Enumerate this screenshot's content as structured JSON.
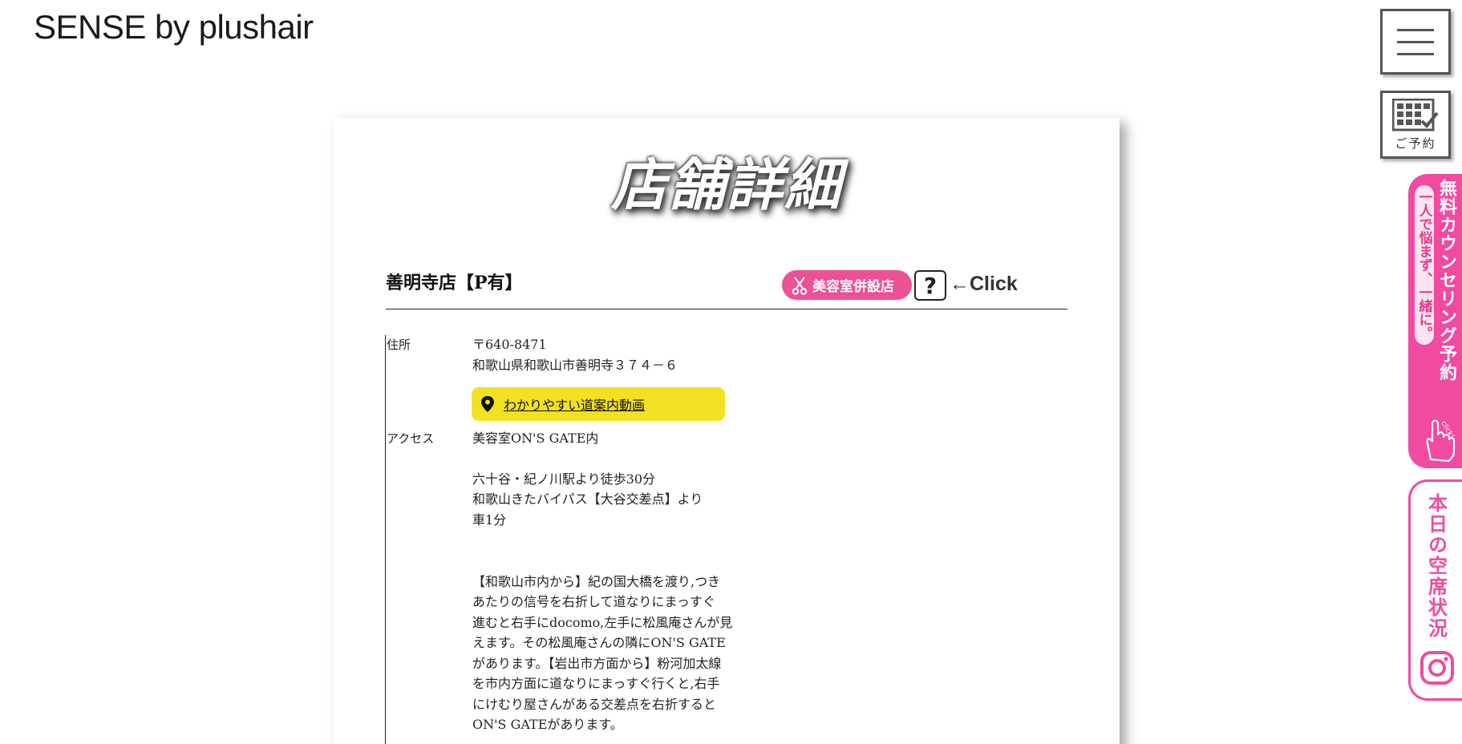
{
  "header": {
    "logo": "SENSE by plushair"
  },
  "side_controls": {
    "reserve_label": "ご予約",
    "counseling_main": "無料カウンセリング予約",
    "counseling_sub": "一人で悩まず、一緒に。",
    "counseling_click": "click!",
    "vacancy_label": "本日の空席状況"
  },
  "page": {
    "title": "店舗詳細"
  },
  "store": {
    "name": "善明寺店【P有】",
    "badge": "美容室併設店",
    "help_symbol": "?",
    "click_hint": "←Click"
  },
  "info": {
    "address_label": "住所",
    "postal": "〒640-8471",
    "address": "和歌山県和歌山市善明寺３７４－６",
    "route_button": "わかりやすい道案内動画",
    "access_label": "アクセス",
    "access_lines": [
      "美容室ON'S GATE内",
      "六十谷・紀ノ川駅より徒歩30分",
      "和歌山きたバイパス【大谷交差点】より",
      "車1分",
      "【和歌山市内から】紀の国大橋を渡り,つき",
      "あたりの信号を右折して道なりにまっすぐ",
      "進むと右手にdocomo,左手に松風庵さんが見",
      "えます。その松風庵さんの隣にON'S GATE",
      "があります。【岩出市方面から】粉河加太線",
      "を市内方面に道なりにまっすぐ行くと,右手",
      "にけむり屋さんがある交差点を右折すると",
      "ON'S GATEがあります。"
    ]
  },
  "colors": {
    "pink": "#f14aa0",
    "yellow": "#f2e023",
    "dark": "#555555"
  }
}
